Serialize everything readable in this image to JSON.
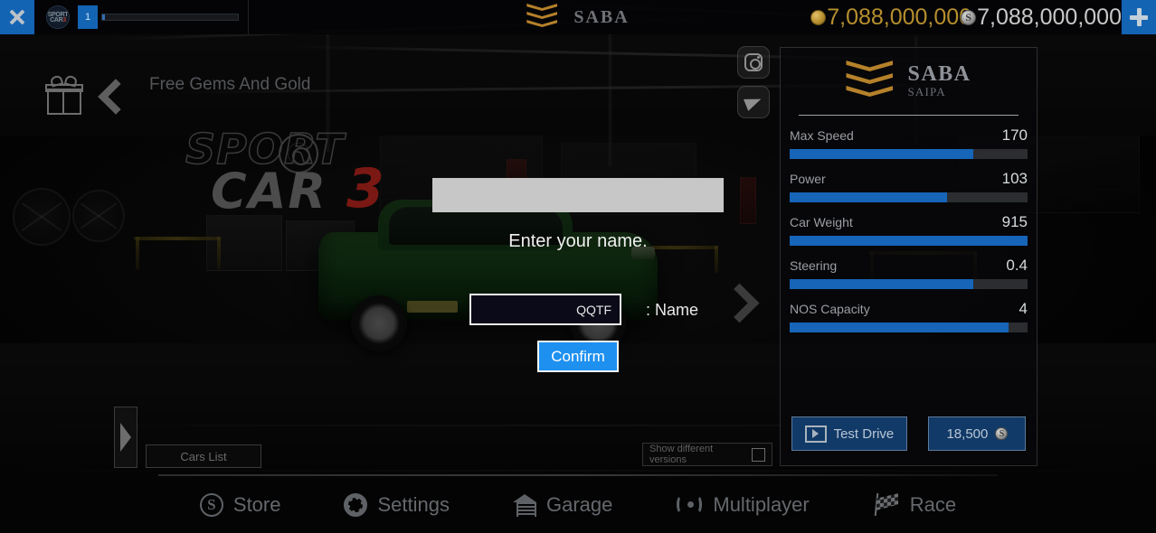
{
  "topbar": {
    "close_icon": "close-x-icon",
    "avatar_line1": "SPORT",
    "avatar_line2": "CAR",
    "avatar_line3": "3",
    "level": "1",
    "xp_percent": 2,
    "brand_title": "SABA",
    "gold_amount": "7,088,000,000",
    "cash_amount": "7,088,000,000",
    "add_icon": "plus-icon",
    "gold_color": "#b68f2e",
    "cash_color": "#c8c8c8",
    "accent_blue": "#1464b4"
  },
  "promo": {
    "gift_icon": "gift-icon",
    "back_icon": "chevron-left-icon",
    "text": "Free Gems And Gold"
  },
  "logo": {
    "sport": "SPORT",
    "car": "CAR",
    "three": "3",
    "three_color": "#7a1813"
  },
  "social": {
    "instagram": "instagram-icon",
    "telegram": "telegram-icon"
  },
  "stats_panel": {
    "car_name": "SABA",
    "manufacturer": "SAIPA",
    "logo_icon": "saipa-chevrons-icon",
    "bar_color": "#1665b8",
    "stats": [
      {
        "label": "Max Speed",
        "value": "170",
        "percent": 77
      },
      {
        "label": "Power",
        "value": "103",
        "percent": 66
      },
      {
        "label": "Car Weight",
        "value": "915",
        "percent": 100
      },
      {
        "label": "Steering",
        "value": "0.4",
        "percent": 77
      },
      {
        "label": "NOS Capacity",
        "value": "4",
        "percent": 92
      }
    ],
    "test_drive_label": "Test Drive",
    "test_drive_icon": "video-play-icon",
    "price_label": "18,500",
    "price_icon": "silver-coin-icon"
  },
  "car_nav": {
    "next_icon": "chevron-right-icon",
    "drawer_icon": "drawer-arrow-icon"
  },
  "garage_controls": {
    "cars_list_label": "Cars List",
    "versions_label": "Show different versions",
    "versions_checked": false
  },
  "dialog": {
    "title": "Enter your name.",
    "input_value": "QQTF",
    "input_placeholder": "Name",
    "field_label": ": Name",
    "confirm_label": "Confirm",
    "confirm_color": "#1e90f0"
  },
  "bottom_nav": [
    {
      "label": "Store",
      "icon": "store-coin-icon"
    },
    {
      "label": "Settings",
      "icon": "gear-icon"
    },
    {
      "label": "Garage",
      "icon": "garage-icon"
    },
    {
      "label": "Multiplayer",
      "icon": "broadcast-icon"
    },
    {
      "label": "Race",
      "icon": "checkered-flag-icon"
    }
  ]
}
